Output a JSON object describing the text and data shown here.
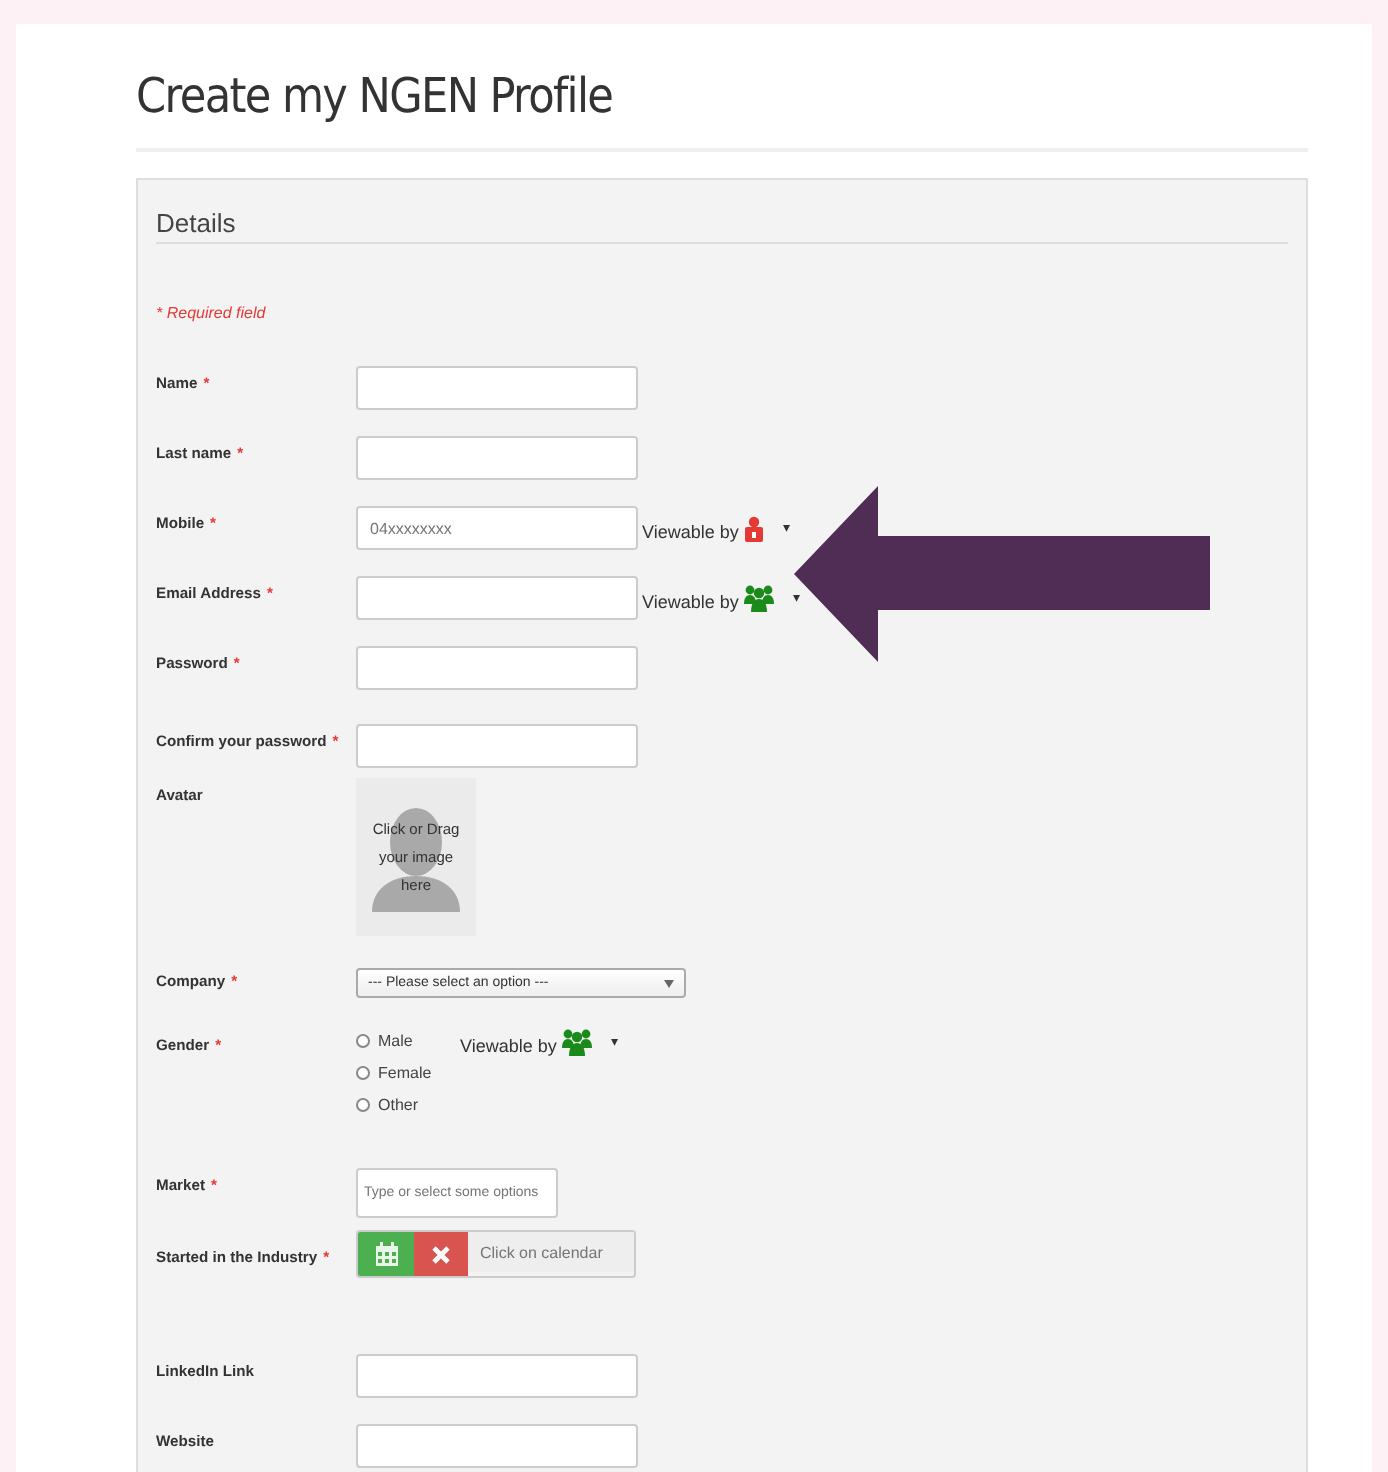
{
  "page_title": "Create my NGEN Profile",
  "section": {
    "title": "Details",
    "required_note": "* Required field"
  },
  "fields": [
    {
      "kind": "text",
      "label": "Name",
      "required_mark": "*"
    },
    {
      "kind": "text",
      "label": "Last name",
      "required_mark": "*"
    },
    {
      "kind": "text",
      "label": "Mobile",
      "required_mark": "*",
      "placeholder": "04xxxxxxxx",
      "viewable": {
        "label": "Viewable by",
        "kind": "private",
        "caret": "▾"
      }
    },
    {
      "kind": "text",
      "label": "Email Address",
      "required_mark": "*",
      "viewable": {
        "label": "Viewable by",
        "kind": "group",
        "caret": "▾"
      }
    },
    {
      "kind": "text",
      "label": "Password",
      "required_mark": "*"
    },
    {
      "kind": "text",
      "label": "Confirm your password",
      "required_mark": "*"
    },
    {
      "kind": "avatar",
      "label": "Avatar",
      "hint": "Click or Drag your image here"
    },
    {
      "kind": "select",
      "label": "Company",
      "required_mark": "*",
      "value": "--- Please select an option ---"
    },
    {
      "kind": "radio",
      "label": "Gender",
      "required_mark": "*",
      "options": [
        {
          "label": "Male",
          "selected": false
        },
        {
          "label": "Female",
          "selected": false
        },
        {
          "label": "Other",
          "selected": false
        }
      ],
      "viewable": {
        "label": "Viewable by",
        "kind": "group",
        "caret": "▾"
      }
    },
    {
      "kind": "multiselect",
      "label": "Market",
      "required_mark": "*",
      "placeholder": "Type or select some options"
    },
    {
      "kind": "date",
      "label": "Started in the Industry",
      "required_mark": "*",
      "placeholder": "Click on calendar"
    },
    {
      "kind": "text",
      "label": "LinkedIn Link"
    },
    {
      "kind": "text",
      "label": "Website"
    }
  ]
}
